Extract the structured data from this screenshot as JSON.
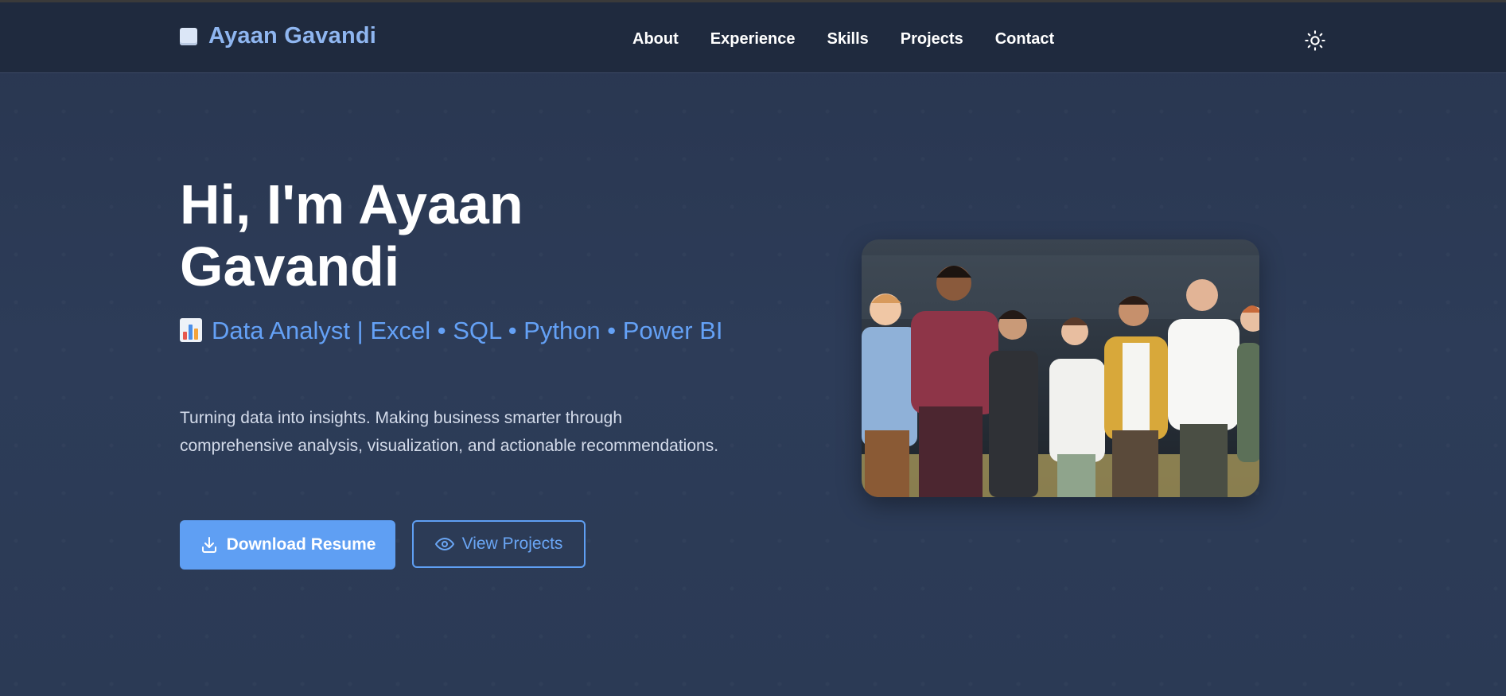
{
  "header": {
    "logo_text": "Ayaan Gavandi",
    "nav": [
      "About",
      "Experience",
      "Skills",
      "Projects",
      "Contact"
    ],
    "theme_icon": "sun-icon"
  },
  "hero": {
    "title": "Hi, I'm Ayaan Gavandi",
    "subtitle_icon": "bar-chart-emoji",
    "subtitle": "Data Analyst | Excel • SQL • Python • Power BI",
    "description": "Turning data into insights. Making business smarter through comprehensive analysis, visualization, and actionable recommendations.",
    "primary_button": {
      "label": "Download Resume",
      "icon": "download-icon"
    },
    "secondary_button": {
      "label": "View Projects",
      "icon": "eye-icon"
    },
    "image": "team-group-photo"
  },
  "colors": {
    "nav_background": "#1f2a3e",
    "page_background": "#2b3a55",
    "accent": "#5f9ff3",
    "logo_text": "#8fb6f0"
  }
}
